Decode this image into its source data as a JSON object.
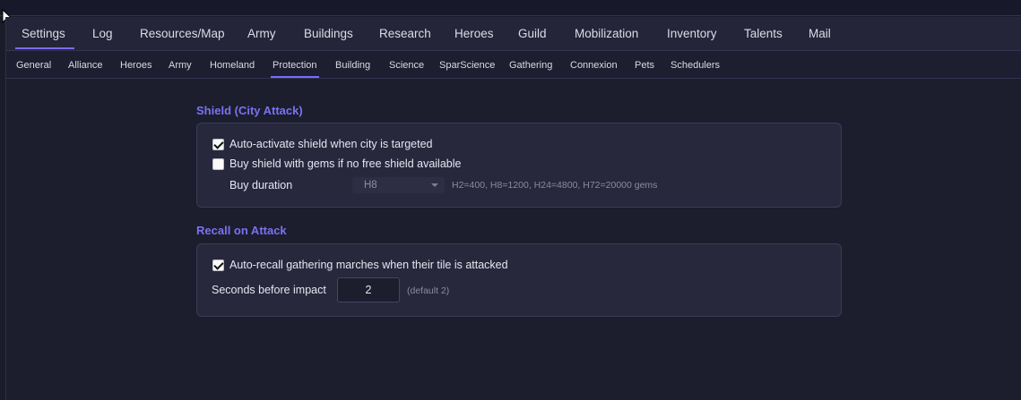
{
  "main_tabs": [
    "Settings",
    "Log",
    "Resources/Map",
    "Army",
    "Buildings",
    "Research",
    "Heroes",
    "Guild",
    "Mobilization",
    "Inventory",
    "Talents",
    "Mail"
  ],
  "sub_tabs": [
    "General",
    "Alliance",
    "Heroes",
    "Army",
    "Homeland",
    "Protection",
    "Building",
    "Science",
    "SparScience",
    "Gathering",
    "Connexion",
    "Pets",
    "Schedulers"
  ],
  "active_main_tab": "Settings",
  "active_sub_tab": "Protection",
  "shield": {
    "title": "Shield (City Attack)",
    "auto_activate": {
      "label": "Auto-activate shield when city is targeted",
      "checked": true
    },
    "buy_with_gems": {
      "label": "Buy shield with gems if no free shield available",
      "checked": false
    },
    "duration_label": "Buy duration",
    "duration_value": "H8",
    "duration_hint": "H2=400, H8=1200, H24=4800, H72=20000 gems"
  },
  "recall": {
    "title": "Recall on Attack",
    "auto_recall": {
      "label": "Auto-recall gathering marches when their tile is attacked",
      "checked": true
    },
    "seconds_label": "Seconds before impact",
    "seconds_value": "2",
    "seconds_hint": "(default 2)"
  },
  "colors": {
    "accent": "#7c6cff",
    "section_title": "#7a72f2",
    "background": "#1c1d2d",
    "card": "#27283c"
  }
}
